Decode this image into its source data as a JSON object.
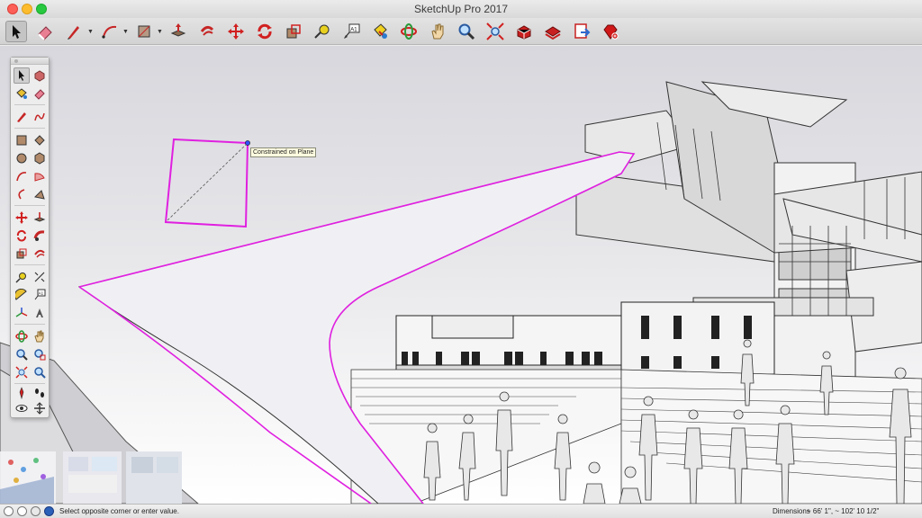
{
  "window": {
    "title": "SketchUp Pro 2017"
  },
  "toolbar": {
    "tools": [
      {
        "name": "select-tool",
        "icon": "arrow-cursor-icon",
        "active": true
      },
      {
        "name": "eraser-tool",
        "icon": "eraser-icon"
      },
      {
        "name": "line-tool",
        "icon": "pencil-icon",
        "dropdown": true
      },
      {
        "name": "arc-tool",
        "icon": "arc-icon",
        "dropdown": true
      },
      {
        "name": "shapes-tool",
        "icon": "rectangle-icon",
        "dropdown": true
      },
      {
        "name": "push-pull-tool",
        "icon": "push-pull-icon"
      },
      {
        "name": "offset-tool",
        "icon": "offset-icon"
      },
      {
        "name": "move-tool",
        "icon": "move-arrows-icon"
      },
      {
        "name": "rotate-tool",
        "icon": "rotate-icon"
      },
      {
        "name": "scale-tool",
        "icon": "scale-icon"
      },
      {
        "name": "tape-measure-tool",
        "icon": "tape-measure-icon"
      },
      {
        "name": "text-tool",
        "icon": "text-label-icon"
      },
      {
        "name": "paint-bucket-tool",
        "icon": "paint-bucket-icon"
      },
      {
        "name": "orbit-tool",
        "icon": "orbit-icon"
      },
      {
        "name": "pan-tool",
        "icon": "hand-icon"
      },
      {
        "name": "zoom-tool",
        "icon": "magnifier-icon"
      },
      {
        "name": "zoom-extents-tool",
        "icon": "zoom-extents-icon"
      },
      {
        "name": "3d-warehouse-tool",
        "icon": "warehouse-icon"
      },
      {
        "name": "extension-warehouse-tool",
        "icon": "extension-icon"
      },
      {
        "name": "send-to-layout-tool",
        "icon": "layout-icon"
      },
      {
        "name": "extension-manager-tool",
        "icon": "ruby-gem-icon"
      }
    ],
    "text_tool_label": "A1"
  },
  "palette": {
    "text_tool_label": "A1"
  },
  "viewport": {
    "tooltip": "Constrained on Plane",
    "accent_color": "#e020e0",
    "inference_color": "#3050ff"
  },
  "statusbar": {
    "status_text": "Select opposite corner or enter value.",
    "dimensions_label": "Dimensions",
    "dimensions_value": "~ 66' 1\", ~ 102' 10 1/2\""
  },
  "colors": {
    "selection": "#e020e0",
    "toolbar_bg": "#d9d9d9",
    "viewport_sky": "#d7d7dd"
  }
}
